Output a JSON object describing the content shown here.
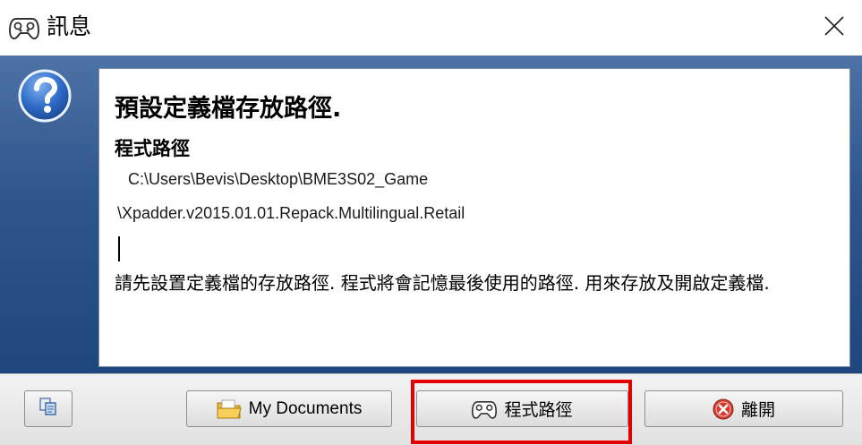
{
  "window": {
    "title": "訊息"
  },
  "message": {
    "title": "預設定義檔存放路徑.",
    "subtitle": "程式路徑",
    "path_line1": "C:\\Users\\Bevis\\Desktop\\BME3S02_Game",
    "path_line2": "\\Xpadder.v2015.01.01.Repack.Multilingual.Retail",
    "description": "請先設置定義檔的存放路徑. 程式將會記憶最後使用的路徑. 用來存放及開啟定義檔."
  },
  "buttons": {
    "my_documents": "My Documents",
    "program_path": "程式路徑",
    "exit": "離開"
  },
  "icons": {
    "title": "gamepad-icon",
    "help": "question-icon",
    "close": "close-icon",
    "copy": "copy-icon",
    "folder": "folder-icon",
    "program": "gamepad-icon",
    "exit": "stop-icon"
  },
  "colors": {
    "highlight": "#e40000",
    "panel_gradient_top": "#4c72a6",
    "panel_gradient_bottom": "#1f467e"
  }
}
